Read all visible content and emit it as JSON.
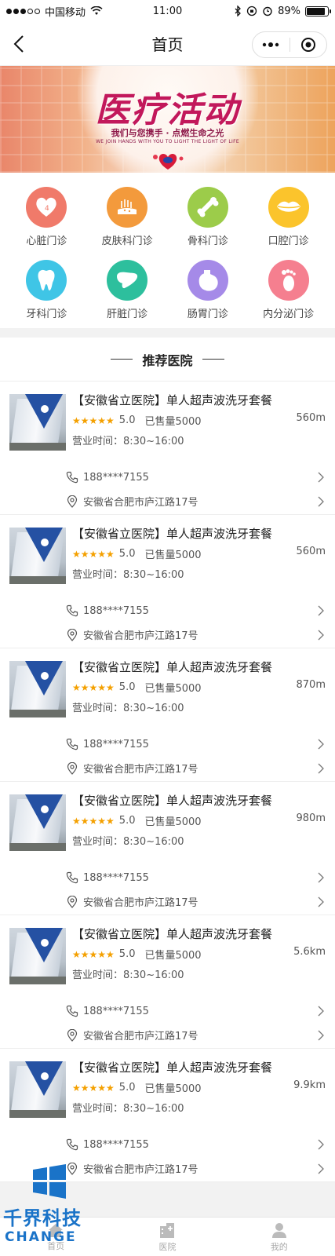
{
  "status_bar": {
    "carrier": "中国移动",
    "time": "11:00",
    "battery": "89%",
    "battery_level": 0.89
  },
  "nav": {
    "title": "首页"
  },
  "banner": {
    "title": "医疗活动",
    "subtitle": "我们与您携手 · 点燃生命之光",
    "subtitle_en": "WE JOIN HANDS WITH YOU TO LIGHT THE LIGHT OF LIFE"
  },
  "categories": [
    {
      "label": "心脏门诊",
      "icon": "heart-icon",
      "color": "#f07a6a"
    },
    {
      "label": "皮肤科门诊",
      "icon": "skin-icon",
      "color": "#f39a3c"
    },
    {
      "label": "骨科门诊",
      "icon": "bone-icon",
      "color": "#9ccc4a"
    },
    {
      "label": "口腔门诊",
      "icon": "lips-icon",
      "color": "#fbc42c"
    },
    {
      "label": "牙科门诊",
      "icon": "tooth-icon",
      "color": "#3fc5e6"
    },
    {
      "label": "肝脏门诊",
      "icon": "liver-icon",
      "color": "#2dbf9d"
    },
    {
      "label": "肠胃门诊",
      "icon": "stomach-icon",
      "color": "#a58ae8"
    },
    {
      "label": "内分泌门诊",
      "icon": "foot-icon",
      "color": "#f57f8f"
    }
  ],
  "recommended": {
    "title": "推荐医院",
    "hospitals": [
      {
        "title": "【安徽省立医院】单人超声波洗牙套餐",
        "stars": "★★★★★",
        "score": "5.0",
        "sold": "已售量5000",
        "distance": "560m",
        "hours": "营业时间：8:30~16:00",
        "phone": "188****7155",
        "address": "安徽省合肥市庐江路17号"
      },
      {
        "title": "【安徽省立医院】单人超声波洗牙套餐",
        "stars": "★★★★★",
        "score": "5.0",
        "sold": "已售量5000",
        "distance": "560m",
        "hours": "营业时间：8:30~16:00",
        "phone": "188****7155",
        "address": "安徽省合肥市庐江路17号"
      },
      {
        "title": "【安徽省立医院】单人超声波洗牙套餐",
        "stars": "★★★★★",
        "score": "5.0",
        "sold": "已售量5000",
        "distance": "870m",
        "hours": "营业时间：8:30~16:00",
        "phone": "188****7155",
        "address": "安徽省合肥市庐江路17号"
      },
      {
        "title": "【安徽省立医院】单人超声波洗牙套餐",
        "stars": "★★★★★",
        "score": "5.0",
        "sold": "已售量5000",
        "distance": "980m",
        "hours": "营业时间：8:30~16:00",
        "phone": "188****7155",
        "address": "安徽省合肥市庐江路17号"
      },
      {
        "title": "【安徽省立医院】单人超声波洗牙套餐",
        "stars": "★★★★★",
        "score": "5.0",
        "sold": "已售量5000",
        "distance": "5.6km",
        "hours": "营业时间：8:30~16:00",
        "phone": "188****7155",
        "address": "安徽省合肥市庐江路17号"
      },
      {
        "title": "【安徽省立医院】单人超声波洗牙套餐",
        "stars": "★★★★★",
        "score": "5.0",
        "sold": "已售量5000",
        "distance": "9.9km",
        "hours": "营业时间：8:30~16:00",
        "phone": "188****7155",
        "address": "安徽省合肥市庐江路17号"
      }
    ]
  },
  "tab_bar": {
    "tabs": [
      {
        "label": "首页",
        "icon": "home-icon"
      },
      {
        "label": "医院",
        "icon": "hospital-icon"
      },
      {
        "label": "我的",
        "icon": "user-icon"
      }
    ]
  },
  "watermark": {
    "text": "千界科技",
    "text_en": "CHANGE"
  }
}
